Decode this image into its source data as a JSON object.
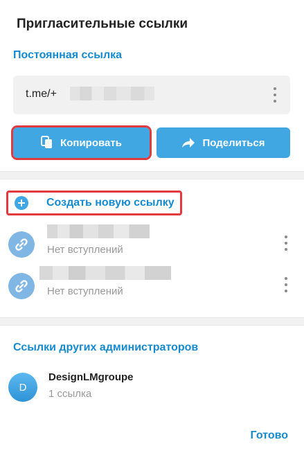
{
  "dialog": {
    "title": "Пригласительные ссылки"
  },
  "permanent_link": {
    "section_title": "Постоянная ссылка",
    "link_prefix": "t.me/+",
    "copy_label": "Копировать",
    "share_label": "Поделиться"
  },
  "invite_links": {
    "create_label": "Создать новую ссылку",
    "items": [
      {
        "status": "Нет вступлений"
      },
      {
        "status": "Нет вступлений"
      }
    ]
  },
  "other_admins": {
    "section_title": "Ссылки других администраторов",
    "items": [
      {
        "initial": "D",
        "name": "DesignLMgroupe",
        "count": "1 ссылка"
      }
    ]
  },
  "footer": {
    "done_label": "Готово"
  },
  "colors": {
    "accent": "#40a7e3",
    "link_text": "#168acd",
    "highlight": "#e0393e",
    "muted": "#999999"
  }
}
